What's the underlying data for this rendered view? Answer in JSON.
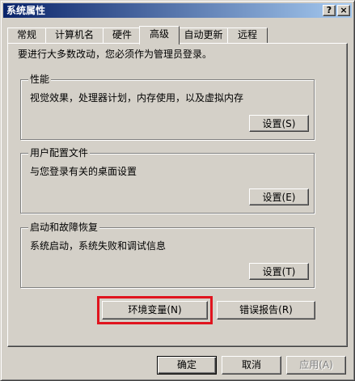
{
  "window": {
    "title": "系统属性",
    "help_glyph": "?",
    "close_glyph": "×"
  },
  "tabs": [
    {
      "label": "常规",
      "active": false
    },
    {
      "label": "计算机名",
      "active": false
    },
    {
      "label": "硬件",
      "active": false
    },
    {
      "label": "高级",
      "active": true
    },
    {
      "label": "自动更新",
      "active": false
    },
    {
      "label": "远程",
      "active": false
    }
  ],
  "notice": "要进行大多数改动，您必须作为管理员登录。",
  "groups": {
    "performance": {
      "title": "性能",
      "desc": "视觉效果，处理器计划，内存使用，以及虚拟内存",
      "button": "设置(S)"
    },
    "user_profiles": {
      "title": "用户配置文件",
      "desc": "与您登录有关的桌面设置",
      "button": "设置(E)"
    },
    "startup_recovery": {
      "title": "启动和故障恢复",
      "desc": "系统启动，系统失败和调试信息",
      "button": "设置(T)"
    }
  },
  "buttons": {
    "env_vars": "环境变量(N)",
    "error_report": "错误报告(R)",
    "ok": "确定",
    "cancel": "取消",
    "apply": "应用(A)"
  },
  "colors": {
    "highlight_box": "#e0141e",
    "titlebar_start": "#0a246a",
    "titlebar_end": "#a6caf0",
    "face": "#d4d0c8"
  }
}
